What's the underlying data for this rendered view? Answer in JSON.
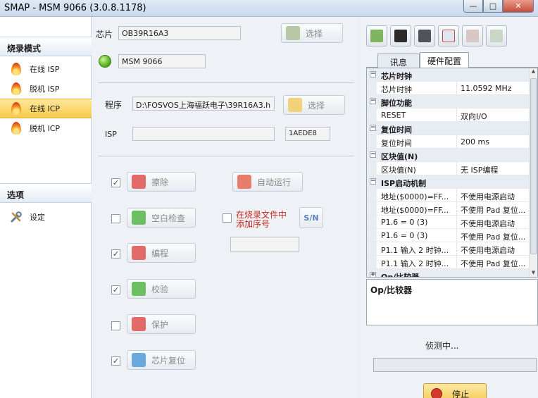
{
  "window": {
    "title": "SMAP - MSM 9066  (3.0.8.1178)",
    "min_label": "—",
    "max_label": "□",
    "close_label": "✕"
  },
  "sidebar": {
    "section1": "烧录模式",
    "items": [
      {
        "label": "在线 ISP",
        "icon": "flame-icon",
        "active": false
      },
      {
        "label": "脱机 ISP",
        "icon": "flame-icon",
        "active": false
      },
      {
        "label": "在线 ICP",
        "icon": "flame-icon",
        "active": true
      },
      {
        "label": "脱机 ICP",
        "icon": "flame-icon",
        "active": false
      }
    ],
    "section2": "选项",
    "settings_label": "设定"
  },
  "chip": {
    "label": "芯片",
    "value": "OB39R16A3",
    "select_label": "选择",
    "device_value": "MSM 9066",
    "led_color": "#5cb21f"
  },
  "program": {
    "label": "程序",
    "path": "D:\\FOSVOS上海福跃电子\\39R16A3.h",
    "select_label": "选择",
    "isp_label": "ISP",
    "isp_value": "",
    "checksum": "1AEDE8"
  },
  "ops": [
    {
      "label": "擦除",
      "checked": true,
      "icon_color": "#e46a6a"
    },
    {
      "label": "空白检查",
      "checked": false,
      "icon_color": "#6cbf62"
    },
    {
      "label": "编程",
      "checked": true,
      "icon_color": "#e46a6a"
    },
    {
      "label": "校验",
      "checked": true,
      "icon_color": "#6cbf62"
    },
    {
      "label": "保护",
      "checked": false,
      "icon_color": "#e46a6a"
    },
    {
      "label": "芯片复位",
      "checked": true,
      "icon_color": "#6aa9e0"
    }
  ],
  "auto_run": {
    "label": "自动运行"
  },
  "serial": {
    "checkbox_label_line1": "在烧录文件中",
    "checkbox_label_line2": "添加序号",
    "checked": false,
    "sn_button_label": "S/N",
    "value": ""
  },
  "toolbar": {
    "icons": [
      "load-icon",
      "chip-icon",
      "config-icon",
      "clear-icon",
      "back-icon",
      "forward-icon"
    ]
  },
  "tabs": [
    {
      "label": "讯息",
      "active": false
    },
    {
      "label": "硬件配置",
      "active": true
    }
  ],
  "grid": {
    "rows": [
      {
        "type": "cat",
        "name": "芯片时钟"
      },
      {
        "type": "prop",
        "key": "芯片时钟",
        "value": "11.0592 MHz"
      },
      {
        "type": "cat",
        "name": "脚位功能"
      },
      {
        "type": "prop",
        "key": "RESET",
        "value": "双向I/O"
      },
      {
        "type": "cat",
        "name": "复位时间"
      },
      {
        "type": "prop",
        "key": "复位时间",
        "value": "200 ms"
      },
      {
        "type": "cat",
        "name": "区块值(N)"
      },
      {
        "type": "prop",
        "key": "区块值(N)",
        "value": "无 ISP编程"
      },
      {
        "type": "cat",
        "name": "ISP启动机制"
      },
      {
        "type": "prop",
        "key": "地址($0000)=FF...",
        "value": "不使用电源启动"
      },
      {
        "type": "prop",
        "key": "地址($0000)=FF...",
        "value": "不使用 Pad 复位..."
      },
      {
        "type": "prop",
        "key": "P1.6 = 0 (3)",
        "value": "不使用电源启动"
      },
      {
        "type": "prop",
        "key": "P1.6 = 0 (3)",
        "value": "不使用 Pad 复位..."
      },
      {
        "type": "prop",
        "key": "P1.1 输入 2 时钟...",
        "value": "不使用电源启动"
      },
      {
        "type": "prop",
        "key": "P1.1 输入 2 时钟...",
        "value": "不使用 Pad 复位..."
      },
      {
        "type": "cat",
        "name": "Op/比较器",
        "collapsed": true
      }
    ],
    "description_title": "Op/比较器"
  },
  "status": {
    "text": "侦测中...",
    "progress": 0
  },
  "stop": {
    "label": "停止"
  }
}
